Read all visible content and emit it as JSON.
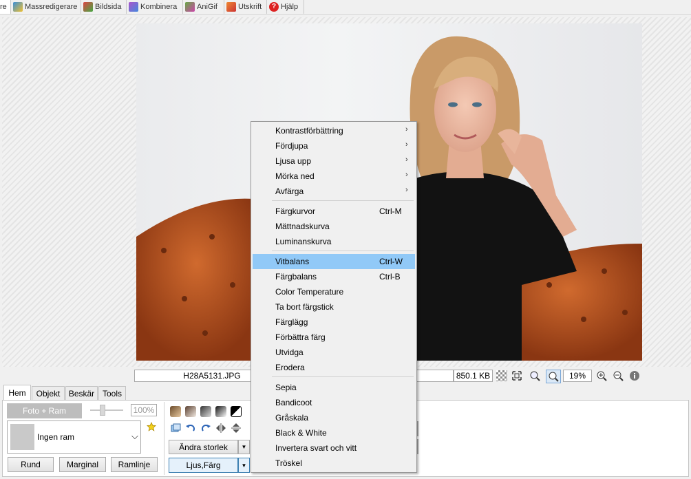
{
  "top_tabs": [
    {
      "label": "re",
      "icon": "editor-icon",
      "active": true
    },
    {
      "label": "Massredigerare",
      "icon": "batch-edit-icon"
    },
    {
      "label": "Bildsida",
      "icon": "page-icon"
    },
    {
      "label": "Kombinera",
      "icon": "combine-icon"
    },
    {
      "label": "AniGif",
      "icon": "anigif-icon"
    },
    {
      "label": "Utskrift",
      "icon": "print-icon"
    },
    {
      "label": "Hjälp",
      "icon": "help-icon",
      "glyph": "?"
    }
  ],
  "status": {
    "filename": "H28A5131.JPG",
    "filesize": "850.1 KB",
    "zoom": "19%"
  },
  "bottom_tabs": [
    "Hem",
    "Objekt",
    "Beskär",
    "Tools"
  ],
  "panel": {
    "foto_ram": "Foto + Ram",
    "opacity": "100%",
    "frame_select": "Ingen ram",
    "rund": "Rund",
    "marginal": "Marginal",
    "ramlinje": "Ramlinje",
    "andra_storlek": "Ändra storlek",
    "ljus_farg": "Ljus,Färg",
    "dropdown_arrow": "▼"
  },
  "menu": {
    "arrow": "›",
    "items": [
      {
        "label": "Kontrastförbättring",
        "submenu": true
      },
      {
        "label": "Fördjupa",
        "submenu": true
      },
      {
        "label": "Ljusa upp",
        "submenu": true
      },
      {
        "label": "Mörka ned",
        "submenu": true
      },
      {
        "label": "Avfärga",
        "submenu": true
      },
      {
        "label": "Färgkurvor",
        "shortcut": "Ctrl-M"
      },
      {
        "label": "Mättnadskurva"
      },
      {
        "label": "Luminanskurva"
      },
      {
        "label": "Vitbalans",
        "shortcut": "Ctrl-W",
        "highlighted": true
      },
      {
        "label": "Färgbalans",
        "shortcut": "Ctrl-B"
      },
      {
        "label": "Color Temperature"
      },
      {
        "label": "Ta bort färgstick"
      },
      {
        "label": "Färglägg"
      },
      {
        "label": "Förbättra färg"
      },
      {
        "label": "Utvidga"
      },
      {
        "label": "Erodera"
      },
      {
        "label": "Sepia"
      },
      {
        "label": "Bandicoot"
      },
      {
        "label": "Gråskala"
      },
      {
        "label": "Black & White"
      },
      {
        "label": "Invertera svart och vitt"
      },
      {
        "label": "Tröskel"
      }
    ]
  },
  "colors": {
    "highlight": "#91c9f7",
    "sofa": "#b8531f",
    "shirt": "#121212"
  }
}
